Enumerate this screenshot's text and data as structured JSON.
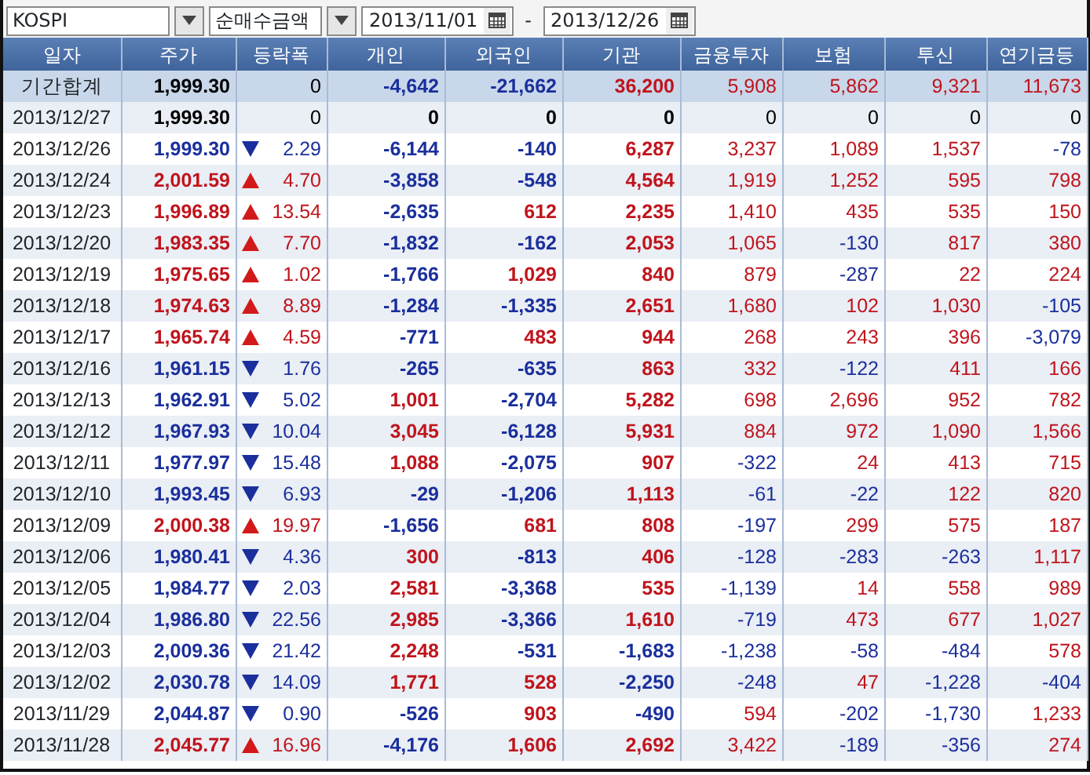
{
  "toolbar": {
    "market": "KOSPI",
    "measure": "순매수금액",
    "date_from": "2013/11/01",
    "separator": "-",
    "date_to": "2013/12/26"
  },
  "table": {
    "columns": [
      "일자",
      "주가",
      "등락폭",
      "개인",
      "외국인",
      "기관",
      "금융투자",
      "보험",
      "투신",
      "연기금등"
    ],
    "rows": [
      {
        "kind": "total",
        "date": "기간합계",
        "price": "1,999.30",
        "up": false,
        "down": false,
        "change": "0",
        "values": [
          "-4,642",
          "-21,662",
          "36,200",
          "5,908",
          "5,862",
          "9,321",
          "11,673"
        ]
      },
      {
        "kind": "day",
        "date": "2013/12/27",
        "price": "1,999.30",
        "up": false,
        "down": false,
        "change": "0",
        "values": [
          "0",
          "0",
          "0",
          "0",
          "0",
          "0",
          "0"
        ]
      },
      {
        "kind": "day",
        "date": "2013/12/26",
        "price": "1,999.30",
        "up": false,
        "down": true,
        "change": "2.29",
        "values": [
          "-6,144",
          "-140",
          "6,287",
          "3,237",
          "1,089",
          "1,537",
          "-78"
        ]
      },
      {
        "kind": "day",
        "date": "2013/12/24",
        "price": "2,001.59",
        "up": true,
        "down": false,
        "change": "4.70",
        "values": [
          "-3,858",
          "-548",
          "4,564",
          "1,919",
          "1,252",
          "595",
          "798"
        ]
      },
      {
        "kind": "day",
        "date": "2013/12/23",
        "price": "1,996.89",
        "up": true,
        "down": false,
        "change": "13.54",
        "values": [
          "-2,635",
          "612",
          "2,235",
          "1,410",
          "435",
          "535",
          "150"
        ]
      },
      {
        "kind": "day",
        "date": "2013/12/20",
        "price": "1,983.35",
        "up": true,
        "down": false,
        "change": "7.70",
        "values": [
          "-1,832",
          "-162",
          "2,053",
          "1,065",
          "-130",
          "817",
          "380"
        ]
      },
      {
        "kind": "day",
        "date": "2013/12/19",
        "price": "1,975.65",
        "up": true,
        "down": false,
        "change": "1.02",
        "values": [
          "-1,766",
          "1,029",
          "840",
          "879",
          "-287",
          "22",
          "224"
        ]
      },
      {
        "kind": "day",
        "date": "2013/12/18",
        "price": "1,974.63",
        "up": true,
        "down": false,
        "change": "8.89",
        "values": [
          "-1,284",
          "-1,335",
          "2,651",
          "1,680",
          "102",
          "1,030",
          "-105"
        ]
      },
      {
        "kind": "day",
        "date": "2013/12/17",
        "price": "1,965.74",
        "up": true,
        "down": false,
        "change": "4.59",
        "values": [
          "-771",
          "483",
          "944",
          "268",
          "243",
          "396",
          "-3,079"
        ]
      },
      {
        "kind": "day",
        "date": "2013/12/16",
        "price": "1,961.15",
        "up": false,
        "down": true,
        "change": "1.76",
        "values": [
          "-265",
          "-635",
          "863",
          "332",
          "-122",
          "411",
          "166"
        ]
      },
      {
        "kind": "day",
        "date": "2013/12/13",
        "price": "1,962.91",
        "up": false,
        "down": true,
        "change": "5.02",
        "values": [
          "1,001",
          "-2,704",
          "5,282",
          "698",
          "2,696",
          "952",
          "782"
        ]
      },
      {
        "kind": "day",
        "date": "2013/12/12",
        "price": "1,967.93",
        "up": false,
        "down": true,
        "change": "10.04",
        "values": [
          "3,045",
          "-6,128",
          "5,931",
          "884",
          "972",
          "1,090",
          "1,566"
        ]
      },
      {
        "kind": "day",
        "date": "2013/12/11",
        "price": "1,977.97",
        "up": false,
        "down": true,
        "change": "15.48",
        "values": [
          "1,088",
          "-2,075",
          "907",
          "-322",
          "24",
          "413",
          "715"
        ]
      },
      {
        "kind": "day",
        "date": "2013/12/10",
        "price": "1,993.45",
        "up": false,
        "down": true,
        "change": "6.93",
        "values": [
          "-29",
          "-1,206",
          "1,113",
          "-61",
          "-22",
          "122",
          "820"
        ]
      },
      {
        "kind": "day",
        "date": "2013/12/09",
        "price": "2,000.38",
        "up": true,
        "down": false,
        "change": "19.97",
        "values": [
          "-1,656",
          "681",
          "808",
          "-197",
          "299",
          "575",
          "187"
        ]
      },
      {
        "kind": "day",
        "date": "2013/12/06",
        "price": "1,980.41",
        "up": false,
        "down": true,
        "change": "4.36",
        "values": [
          "300",
          "-813",
          "406",
          "-128",
          "-283",
          "-263",
          "1,117"
        ]
      },
      {
        "kind": "day",
        "date": "2013/12/05",
        "price": "1,984.77",
        "up": false,
        "down": true,
        "change": "2.03",
        "values": [
          "2,581",
          "-3,368",
          "535",
          "-1,139",
          "14",
          "558",
          "989"
        ]
      },
      {
        "kind": "day",
        "date": "2013/12/04",
        "price": "1,986.80",
        "up": false,
        "down": true,
        "change": "22.56",
        "values": [
          "2,985",
          "-3,366",
          "1,610",
          "-719",
          "473",
          "677",
          "1,027"
        ]
      },
      {
        "kind": "day",
        "date": "2013/12/03",
        "price": "2,009.36",
        "up": false,
        "down": true,
        "change": "21.42",
        "values": [
          "2,248",
          "-531",
          "-1,683",
          "-1,238",
          "-58",
          "-484",
          "578"
        ]
      },
      {
        "kind": "day",
        "date": "2013/12/02",
        "price": "2,030.78",
        "up": false,
        "down": true,
        "change": "14.09",
        "values": [
          "1,771",
          "528",
          "-2,250",
          "-248",
          "47",
          "-1,228",
          "-404"
        ]
      },
      {
        "kind": "day",
        "date": "2013/11/29",
        "price": "2,044.87",
        "up": false,
        "down": true,
        "change": "0.90",
        "values": [
          "-526",
          "903",
          "-490",
          "594",
          "-202",
          "-1,730",
          "1,233"
        ]
      },
      {
        "kind": "day",
        "date": "2013/11/28",
        "price": "2,045.77",
        "up": true,
        "down": false,
        "change": "16.96",
        "values": [
          "-4,176",
          "1,606",
          "2,692",
          "3,422",
          "-189",
          "-356",
          "274"
        ]
      }
    ]
  }
}
